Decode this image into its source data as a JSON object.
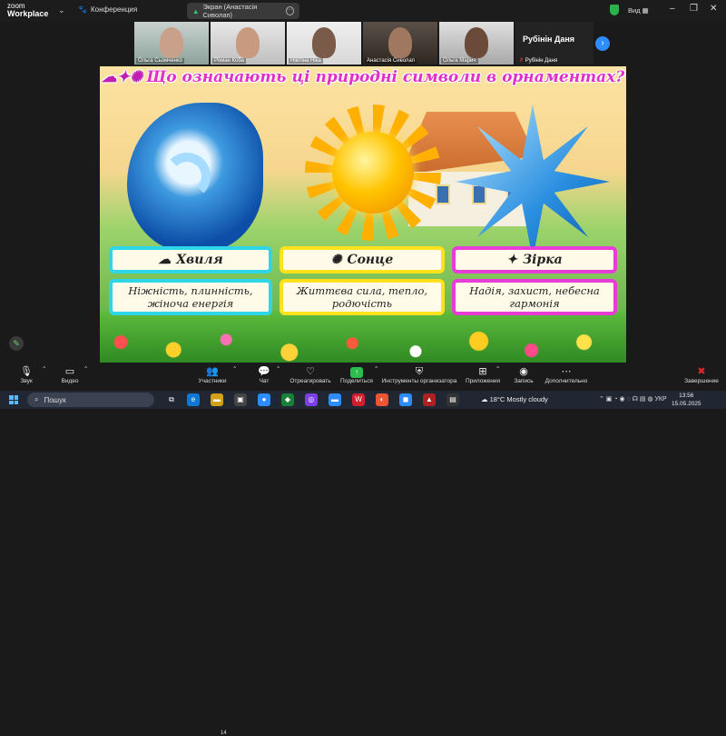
{
  "topbar": {
    "logo_top": "zoom",
    "logo_bottom": "Workplace",
    "conference_label": "Конференция",
    "share_title": "Экран (Анастасія Сиволап)",
    "view_label": "Вид"
  },
  "participants": [
    {
      "name": "Ольга Сьомченко"
    },
    {
      "name": "Роман Коба"
    },
    {
      "name": "Нікітіна Ніка"
    },
    {
      "name": "Анастасія Сиволап"
    },
    {
      "name": "Ольга Марич"
    }
  ],
  "participant_text_tile": {
    "big_name": "Рубінін Даня",
    "small_name": "Рубінін Даня"
  },
  "slide": {
    "title": "Що означають ці природні символи в орнаментах?",
    "title_symbols": "☁✦✺",
    "cards": [
      {
        "label": "Хвиля",
        "label_icon": "☁",
        "description": "Ніжність, плинність, жіноча енергія"
      },
      {
        "label": "Сонце",
        "label_icon": "✺",
        "description": "Життєва сила, тепло, родючість"
      },
      {
        "label": "Зірка",
        "label_icon": "✦",
        "description": "Надія, захист, небесна гармонія"
      }
    ]
  },
  "controls": {
    "audio": "Звук",
    "video": "Видео",
    "participants": "Участники",
    "participants_count": "14",
    "chat": "Чат",
    "react": "Отреагировать",
    "share": "Поделиться",
    "host_tools": "Инструменты организатора",
    "apps": "Приложения",
    "record": "Запись",
    "more": "Дополнительно",
    "end": "Завершение"
  },
  "taskbar": {
    "search": "Пошук",
    "weather": "18°C  Mostly cloudy",
    "language": "УКР",
    "time": "13:56",
    "date": "15.05.2025"
  }
}
